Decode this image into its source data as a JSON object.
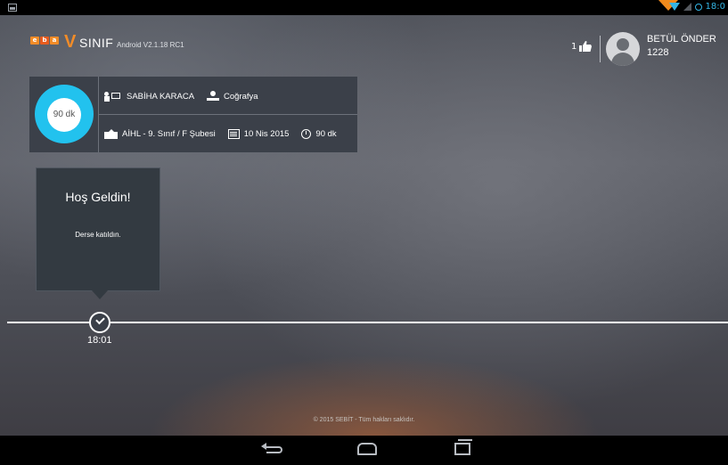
{
  "status_bar": {
    "time": "18:0",
    "icons": [
      "notification-icon",
      "wifi-icon",
      "signal-icon",
      "alarm-icon"
    ]
  },
  "header": {
    "logo_letters": [
      "e",
      "b",
      "a"
    ],
    "app_name": "SINIF",
    "app_version": "Android V2.1.18 RC1"
  },
  "user": {
    "likes": "1",
    "name": "BETÜL ÖNDER",
    "id": "1228"
  },
  "lesson": {
    "timer": "90 dk",
    "teacher": "SABİHA KARACA",
    "subject": "Coğrafya",
    "class": "AİHL -  9. Sınıf / F Şubesi",
    "date": "10 Nis 2015",
    "duration": "90 dk"
  },
  "welcome": {
    "title": "Hoş Geldin!",
    "message": "Derse katıldın."
  },
  "timeline": {
    "event_time": "18:01"
  },
  "footer": {
    "copyright": "© 2015 SEBİT - Tüm hakları saklıdır."
  },
  "colors": {
    "accent_cyan": "#22c2ee",
    "brand_orange": "#f28c28",
    "status_blue": "#33b5e5"
  }
}
